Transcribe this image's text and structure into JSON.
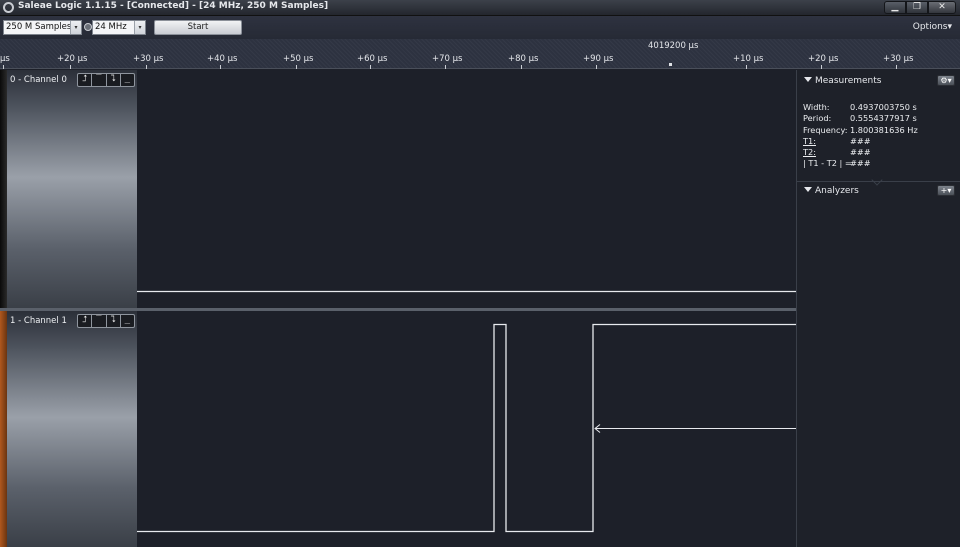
{
  "window": {
    "title": "Saleae Logic 1.1.15 - [Connected] - [24 MHz, 250 M Samples]",
    "min_glyph": "▁",
    "max_glyph": "❐",
    "close_glyph": "✕"
  },
  "toolbar": {
    "samples_value": "250 M Samples",
    "rate_value": "24 MHz",
    "start_label": "Start",
    "options_label": "Options▾",
    "dropdown_glyph": "▾"
  },
  "ruler": {
    "center_label": "4019200 µs",
    "ticks": [
      {
        "label": "µs"
      },
      {
        "label": "+20 µs"
      },
      {
        "label": "+30 µs"
      },
      {
        "label": "+40 µs"
      },
      {
        "label": "+50 µs"
      },
      {
        "label": "+60 µs"
      },
      {
        "label": "+70 µs"
      },
      {
        "label": "+80 µs"
      },
      {
        "label": "+90 µs"
      },
      {
        "label": "+10 µs"
      },
      {
        "label": "+20 µs"
      },
      {
        "label": "+30 µs"
      }
    ]
  },
  "channels": [
    {
      "name": "0 - Channel 0",
      "trigger_buttons": [
        "⮥",
        "‾",
        "⮧",
        "_"
      ]
    },
    {
      "name": "1 - Channel 1",
      "trigger_buttons": [
        "⮥",
        "‾",
        "⮧",
        "_"
      ]
    }
  ],
  "panel": {
    "measurements_title": "Measurements",
    "analyzers_title": "Analyzers",
    "gear_glyph": "⚙▾",
    "add_glyph": "+▾",
    "measurements": [
      {
        "key": "Width:",
        "value": "0.4937003750 s"
      },
      {
        "key": "Period:",
        "value": "0.5554377917 s"
      },
      {
        "key": "Frequency:",
        "value": "1.800381636 Hz"
      },
      {
        "key": "T1:",
        "value": "###"
      },
      {
        "key": "T2:",
        "value": "###"
      },
      {
        "key": "| T1 - T2 | =",
        "value": "###"
      }
    ]
  }
}
